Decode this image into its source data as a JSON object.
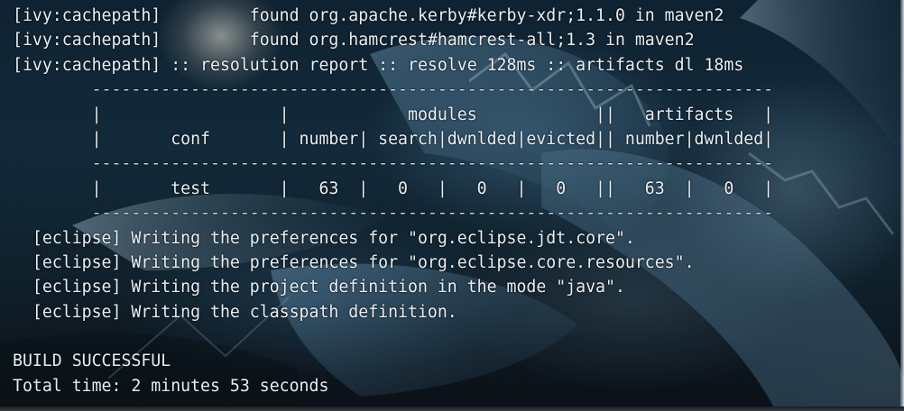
{
  "terminal": {
    "lines": [
      "[ivy:cachepath]         found org.apache.kerby#kerby-xdr;1.1.0 in maven2",
      "[ivy:cachepath]         found org.hamcrest#hamcrest-all;1.3 in maven2",
      "[ivy:cachepath] :: resolution report :: resolve 128ms :: artifacts dl 18ms",
      "        ---------------------------------------------------------------------",
      "        |                  |            modules            ||   artifacts   |",
      "        |       conf       | number| search|dwnlded|evicted|| number|dwnlded|",
      "        ---------------------------------------------------------------------",
      "        |       test       |   63  |   0   |   0   |   0   ||   63  |   0   |",
      "        ---------------------------------------------------------------------",
      "  [eclipse] Writing the preferences for \"org.eclipse.jdt.core\".",
      "  [eclipse] Writing the preferences for \"org.eclipse.core.resources\".",
      "  [eclipse] Writing the project definition in the mode \"java\".",
      "  [eclipse] Writing the classpath definition.",
      "",
      "BUILD SUCCESSFUL",
      "Total time: 2 minutes 53 seconds"
    ]
  },
  "colors": {
    "text": "#e9eef2",
    "background": "#132a3a"
  }
}
